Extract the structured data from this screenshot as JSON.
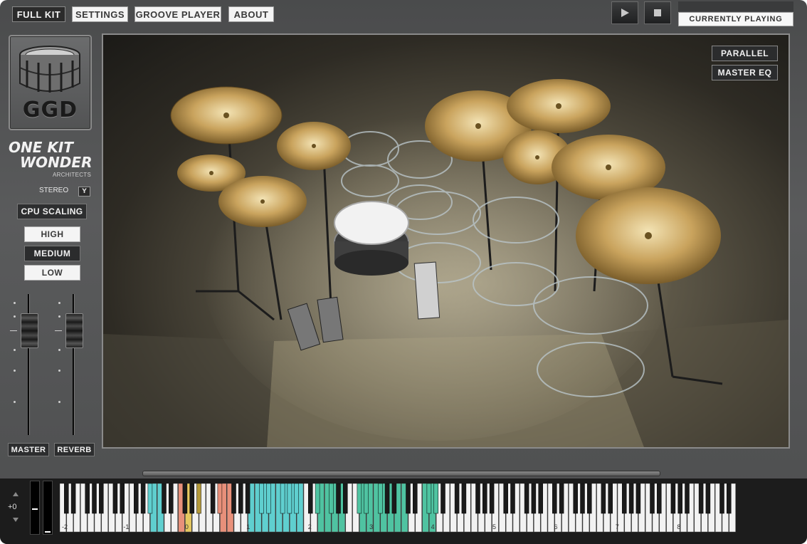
{
  "nav": {
    "tabs": [
      "FULL KIT",
      "SETTINGS",
      "GROOVE PLAYER",
      "ABOUT"
    ],
    "active_tab": "FULL KIT"
  },
  "transport": {
    "play_icon": "play-icon",
    "stop_icon": "stop-icon"
  },
  "status": {
    "now_playing": "CURRENTLY PLAYING"
  },
  "branding": {
    "logo": "GGD",
    "product_line1": "ONE KIT",
    "product_line2": "WONDER",
    "product_sub": "ARCHITECTS"
  },
  "output": {
    "stereo_label": "STEREO",
    "stereo_toggle": "Y"
  },
  "cpu": {
    "label": "CPU SCALING",
    "options": [
      "HIGH",
      "MEDIUM",
      "LOW"
    ],
    "selected": "MEDIUM"
  },
  "mixer": {
    "master_label": "MASTER",
    "reverb_label": "REVERB",
    "master_level": 0.75,
    "reverb_level": 0.75
  },
  "view_buttons": {
    "parallel": "PARALLEL",
    "master_eq": "MASTER EQ"
  },
  "keyboard": {
    "octave_shift": "+0",
    "octave_labels": [
      "-2",
      "-1",
      "0",
      "1",
      "2",
      "3",
      "4",
      "5",
      "6",
      "7",
      "8"
    ]
  },
  "colors": {
    "cyan": "#5fcfcf",
    "teal": "#4fc3a1",
    "salmon": "#e8907a",
    "yellow": "#e6c860",
    "olive": "#b59a3a",
    "red": "#d9534f"
  }
}
